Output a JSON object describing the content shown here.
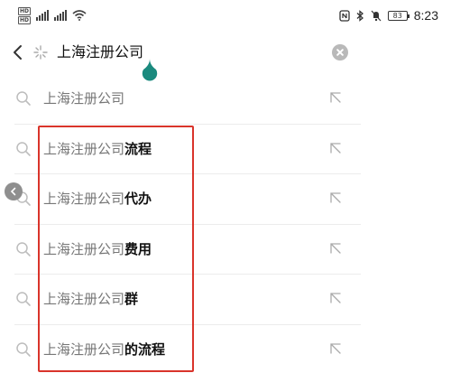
{
  "status_bar": {
    "hd1": "HD",
    "hd2": "HD",
    "sig1_gen": "4G",
    "sig2_gen": "4G",
    "battery_level": "83",
    "time": "8:23"
  },
  "search": {
    "query": "上海注册公司"
  },
  "suggestions": [
    {
      "prefix": "上海注册公司",
      "suffix": ""
    },
    {
      "prefix": "上海注册公司",
      "suffix": "流程"
    },
    {
      "prefix": "上海注册公司",
      "suffix": "代办"
    },
    {
      "prefix": "上海注册公司",
      "suffix": "费用"
    },
    {
      "prefix": "上海注册公司",
      "suffix": "群"
    },
    {
      "prefix": "上海注册公司",
      "suffix": "的流程"
    }
  ],
  "colors": {
    "highlight_border": "#d9342b",
    "cursor_handle": "#1a8a7e",
    "clear_button": "#b9b9b9"
  },
  "icons": {
    "back": "chevron-left-icon",
    "assistant": "spark-icon",
    "clear": "close-circle-icon",
    "suggestion": "search-icon",
    "fill": "arrow-up-left-icon"
  }
}
